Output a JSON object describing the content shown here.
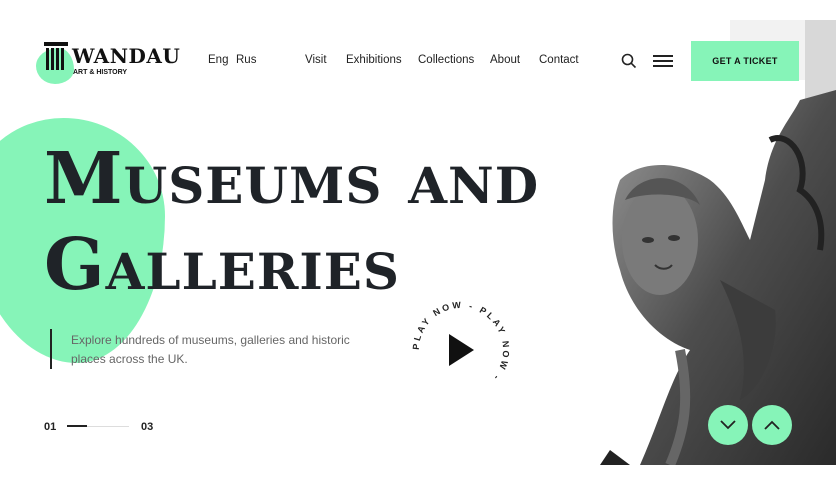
{
  "brand": {
    "name": "WANDAU",
    "tagline": "ART & HISTORY"
  },
  "languages": [
    "Eng",
    "Rus"
  ],
  "nav": [
    "Visit",
    "Exhibitions",
    "Collections",
    "About",
    "Contact"
  ],
  "cta": {
    "label": "GET A TICKET"
  },
  "hero": {
    "title_line1": "Museums and",
    "title_line2": "Galleries",
    "description": "Explore hundreds of museums, galleries and historic places across the UK."
  },
  "play": {
    "label": "PLAY NOW - PLAY NOW - "
  },
  "slider": {
    "current": "01",
    "total": "03",
    "progress": 0.33
  },
  "icons": [
    "search-icon",
    "menu-icon",
    "play-icon",
    "chevron-down-icon",
    "chevron-up-icon"
  ],
  "colors": {
    "accent": "#86f4b8",
    "text": "#1f2328",
    "muted": "#666666"
  }
}
